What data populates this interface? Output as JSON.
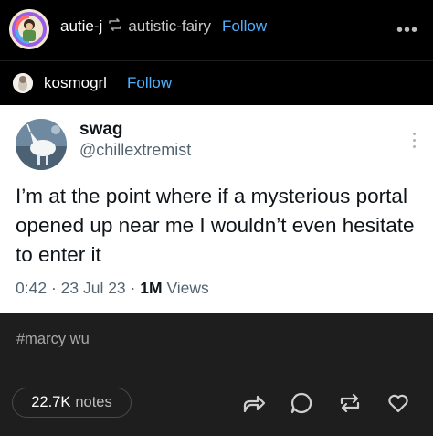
{
  "post": {
    "author": "autie-j",
    "reblog_icon": "reblog-icon",
    "reblogged_from": "autistic-fairy",
    "follow_label": "Follow",
    "more_icon": "more-dots-icon"
  },
  "source": {
    "user": "kosmogrl",
    "follow_label": "Follow"
  },
  "tweet": {
    "display_name": "swag",
    "handle": "@chillextremist",
    "text": "I’m at the point where if a mysterious portal opened up near me I wouldn’t even hesitate to enter it",
    "time": "0:42",
    "dot1": "·",
    "date": "23 Jul 23",
    "dot2": "·",
    "views_count": "1M",
    "views_label": "Views",
    "kebab_icon": "vertical-dots-icon"
  },
  "footer": {
    "tag": "#marcy wu",
    "notes_count": "22.7K",
    "notes_label": "notes",
    "actions": [
      "share-icon",
      "comment-icon",
      "reblog-icon",
      "like-icon"
    ]
  },
  "colors": {
    "background": "#000000",
    "accent": "#4fb1ff",
    "footer_bg": "#1e1e1e",
    "tweet_bg": "#ffffff"
  }
}
